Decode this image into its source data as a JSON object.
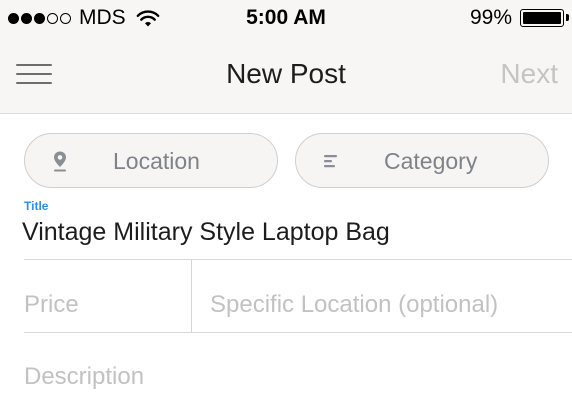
{
  "status_bar": {
    "carrier": "MDS",
    "signal_bars_filled": 3,
    "signal_bars_total": 5,
    "time": "5:00 AM",
    "battery_percent": "99%",
    "battery_level": 0.99
  },
  "nav": {
    "title": "New Post",
    "next_label": "Next"
  },
  "filters": {
    "location_label": "Location",
    "category_label": "Category"
  },
  "form": {
    "title_caption": "Title",
    "title_value": "Vintage Military Style Laptop Bag",
    "price_placeholder": "Price",
    "specific_location_placeholder": "Specific Location (optional)",
    "description_placeholder": "Description"
  },
  "colors": {
    "accent": "#2f8fe6",
    "bar_background": "#f7f6f5",
    "placeholder": "#c2c2c2",
    "disabled_next": "#c4c4c4"
  },
  "icons": {
    "menu": "hamburger-menu-icon",
    "location": "map-pin-icon",
    "category": "category-list-icon"
  }
}
